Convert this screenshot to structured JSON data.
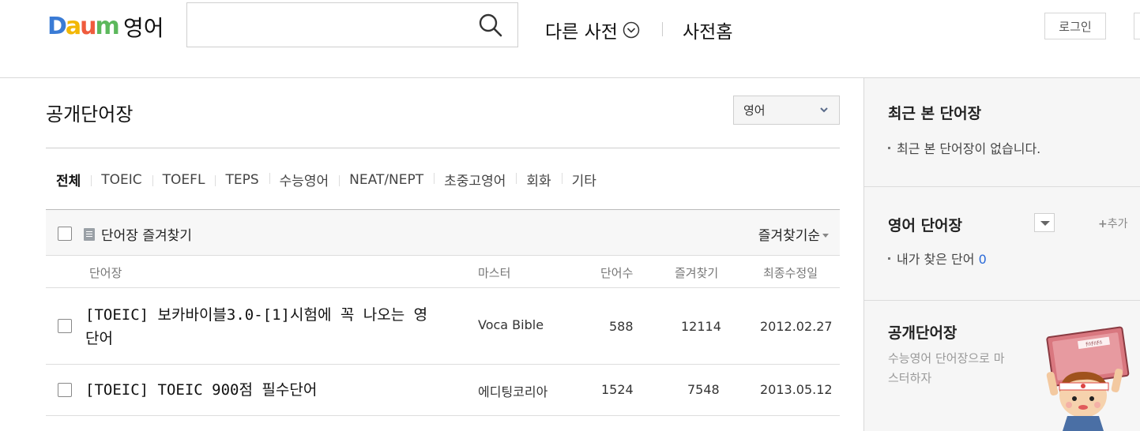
{
  "header": {
    "logo_text": "Daum",
    "service_name": "영어",
    "search_placeholder": "",
    "search_value": "",
    "other_dict_label": "다른 사전",
    "dict_home_label": "사전홈",
    "login_label": "로그인"
  },
  "main": {
    "title": "공개단어장",
    "language_select": "영어",
    "categories": [
      "전체",
      "TOEIC",
      "TOEFL",
      "TEPS",
      "수능영어",
      "NEAT/NEPT",
      "초중고영어",
      "회화",
      "기타"
    ],
    "favorite_button": "단어장 즐겨찾기",
    "sort_label": "즐겨찾기순",
    "columns": {
      "title": "단어장",
      "master": "마스터",
      "word_count": "단어수",
      "favorites": "즐겨찾기",
      "updated": "최종수정일"
    },
    "rows": [
      {
        "title": "[TOEIC] 보카바이블3.0-[1]시험에 꼭 나오는 영단어",
        "master": "Voca Bible",
        "word_count": "588",
        "favorites": "12114",
        "updated": "2012.02.27"
      },
      {
        "title": "[TOEIC] TOEIC 900점 필수단어",
        "master": "에디팅코리아",
        "word_count": "1524",
        "favorites": "7548",
        "updated": "2013.05.12"
      }
    ]
  },
  "sidebar": {
    "recent_title": "최근 본 단어장",
    "recent_empty": "최근 본 단어장이 없습니다.",
    "my_title": "영어 단어장",
    "add_label": "추가",
    "my_words_label": "내가 찾은 단어",
    "my_words_count": "0",
    "promo_title": "공개단어장",
    "promo_subtitle": "수능영어 단어장으로 마스터하자",
    "promo_book_text": "ﾁﾊﾁﾊﾁﾊ"
  },
  "colors": {
    "link_blue": "#2b6ad8",
    "logo_blue": "#3a7bd5",
    "logo_yellow": "#f2b705",
    "logo_red": "#ef5b3d",
    "logo_green": "#5cb85c"
  }
}
